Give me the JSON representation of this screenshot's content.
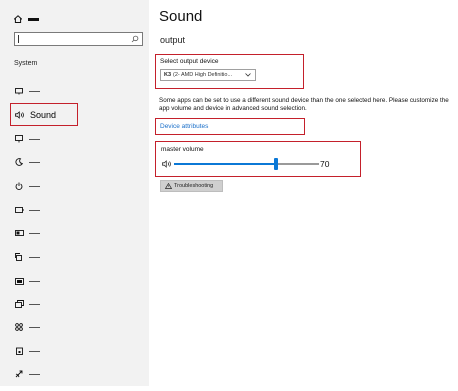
{
  "page": {
    "title": "Sound",
    "subtitle": "output"
  },
  "sidebar": {
    "search_placeholder": "",
    "section_label": "System",
    "active_item": {
      "label": "Sound",
      "icon": "speaker-icon"
    },
    "items": [
      {
        "icon": "monitor-icon"
      },
      {
        "icon": "notification-icon"
      },
      {
        "icon": "moon-icon"
      },
      {
        "icon": "power-icon"
      },
      {
        "icon": "battery-icon"
      },
      {
        "icon": "storage-icon"
      },
      {
        "icon": "tablet-icon"
      },
      {
        "icon": "multitask-icon"
      },
      {
        "icon": "projecting-icon"
      },
      {
        "icon": "shared-experiences-icon"
      },
      {
        "icon": "clipboard-icon"
      },
      {
        "icon": "remote-desktop-icon"
      }
    ]
  },
  "output": {
    "device_label": "Select output device",
    "device_value": "(2- AMD High Definitio...",
    "device_icon_text": "K3"
  },
  "info_text": "Some apps can be set to use a different sound device than the one selected here. Please customize the app volume and device in advanced sound selection.",
  "device_attributes_link": "Device attributes",
  "volume": {
    "label": "master volume",
    "value": "70",
    "level": 0.7
  },
  "troubleshoot": {
    "label": "Troubleshooting"
  },
  "colors": {
    "accent": "#0b78d6",
    "highlight": "#c4202b",
    "link": "#1a6fc9",
    "sidebar_bg": "#f2f2f2"
  }
}
